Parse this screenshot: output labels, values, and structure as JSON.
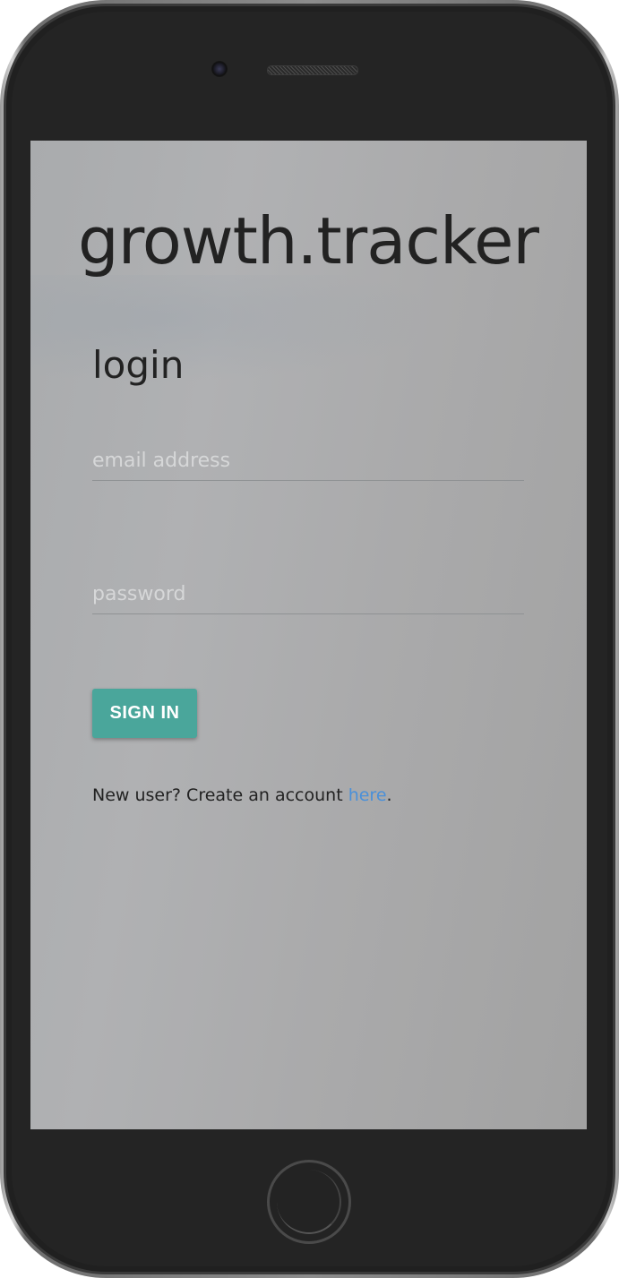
{
  "app": {
    "title": "growth.tracker"
  },
  "login": {
    "heading": "login",
    "email": {
      "placeholder": "email address",
      "value": ""
    },
    "password": {
      "placeholder": "password",
      "value": ""
    },
    "submit_label": "SIGN IN"
  },
  "register": {
    "prefix": "New user? Create an account ",
    "link_label": "here",
    "suffix": "."
  },
  "colors": {
    "accent": "#4aa69b",
    "link": "#4a90d9",
    "text": "#222222"
  },
  "device": {
    "icons": [
      "camera-icon",
      "speaker-grille-icon",
      "home-button-icon"
    ]
  }
}
